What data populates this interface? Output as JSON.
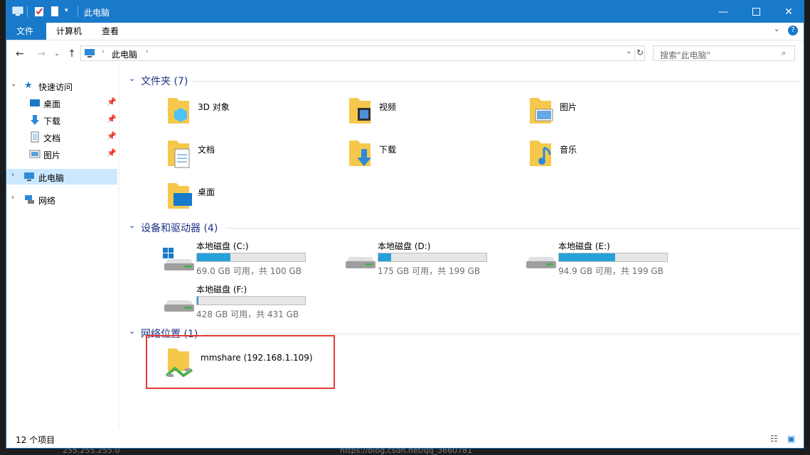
{
  "window": {
    "title": "此电脑"
  },
  "ribbon": {
    "tabs": [
      "文件",
      "计算机",
      "查看"
    ]
  },
  "address": {
    "path": "此电脑"
  },
  "search": {
    "placeholder": "搜索\"此电脑\""
  },
  "sidebar": {
    "quick_access": "快速访问",
    "items": [
      {
        "label": "桌面",
        "icon": "desktop-icon",
        "pinned": true
      },
      {
        "label": "下载",
        "icon": "download-icon",
        "pinned": true
      },
      {
        "label": "文档",
        "icon": "document-icon",
        "pinned": true
      },
      {
        "label": "图片",
        "icon": "picture-icon",
        "pinned": true
      }
    ],
    "this_pc": "此电脑",
    "network": "网络"
  },
  "groups": {
    "folders": {
      "title": "文件夹 (7)"
    },
    "drives": {
      "title": "设备和驱动器 (4)"
    },
    "network": {
      "title": "网络位置 (1)"
    }
  },
  "folders": [
    {
      "name": "3D 对象",
      "icon": "3d-objects-folder-icon"
    },
    {
      "name": "视频",
      "icon": "videos-folder-icon"
    },
    {
      "name": "图片",
      "icon": "pictures-folder-icon"
    },
    {
      "name": "文档",
      "icon": "documents-folder-icon"
    },
    {
      "name": "下载",
      "icon": "downloads-folder-icon"
    },
    {
      "name": "音乐",
      "icon": "music-folder-icon"
    },
    {
      "name": "桌面",
      "icon": "desktop-folder-icon"
    }
  ],
  "drives": [
    {
      "name": "本地磁盘 (C:)",
      "size": "69.0 GB 可用，共 100 GB",
      "used_fraction": 0.31
    },
    {
      "name": "本地磁盘 (D:)",
      "size": "175 GB 可用，共 199 GB",
      "used_fraction": 0.12
    },
    {
      "name": "本地磁盘 (E:)",
      "size": "94.9 GB 可用，共 199 GB",
      "used_fraction": 0.52
    },
    {
      "name": "本地磁盘 (F:)",
      "size": "428 GB 可用，共 431 GB",
      "used_fraction": 0.01
    }
  ],
  "network_locations": [
    {
      "name": "mmshare (192.168.1.109)"
    }
  ],
  "status": {
    "count": "12 个项目"
  },
  "background": {
    "url": "https://blog.csdn.net/qq_3660781",
    "ip": "255.255.255.0"
  },
  "colors": {
    "accent": "#1979ca",
    "drive_fill": "#26a0da",
    "highlight": "#e53935"
  }
}
